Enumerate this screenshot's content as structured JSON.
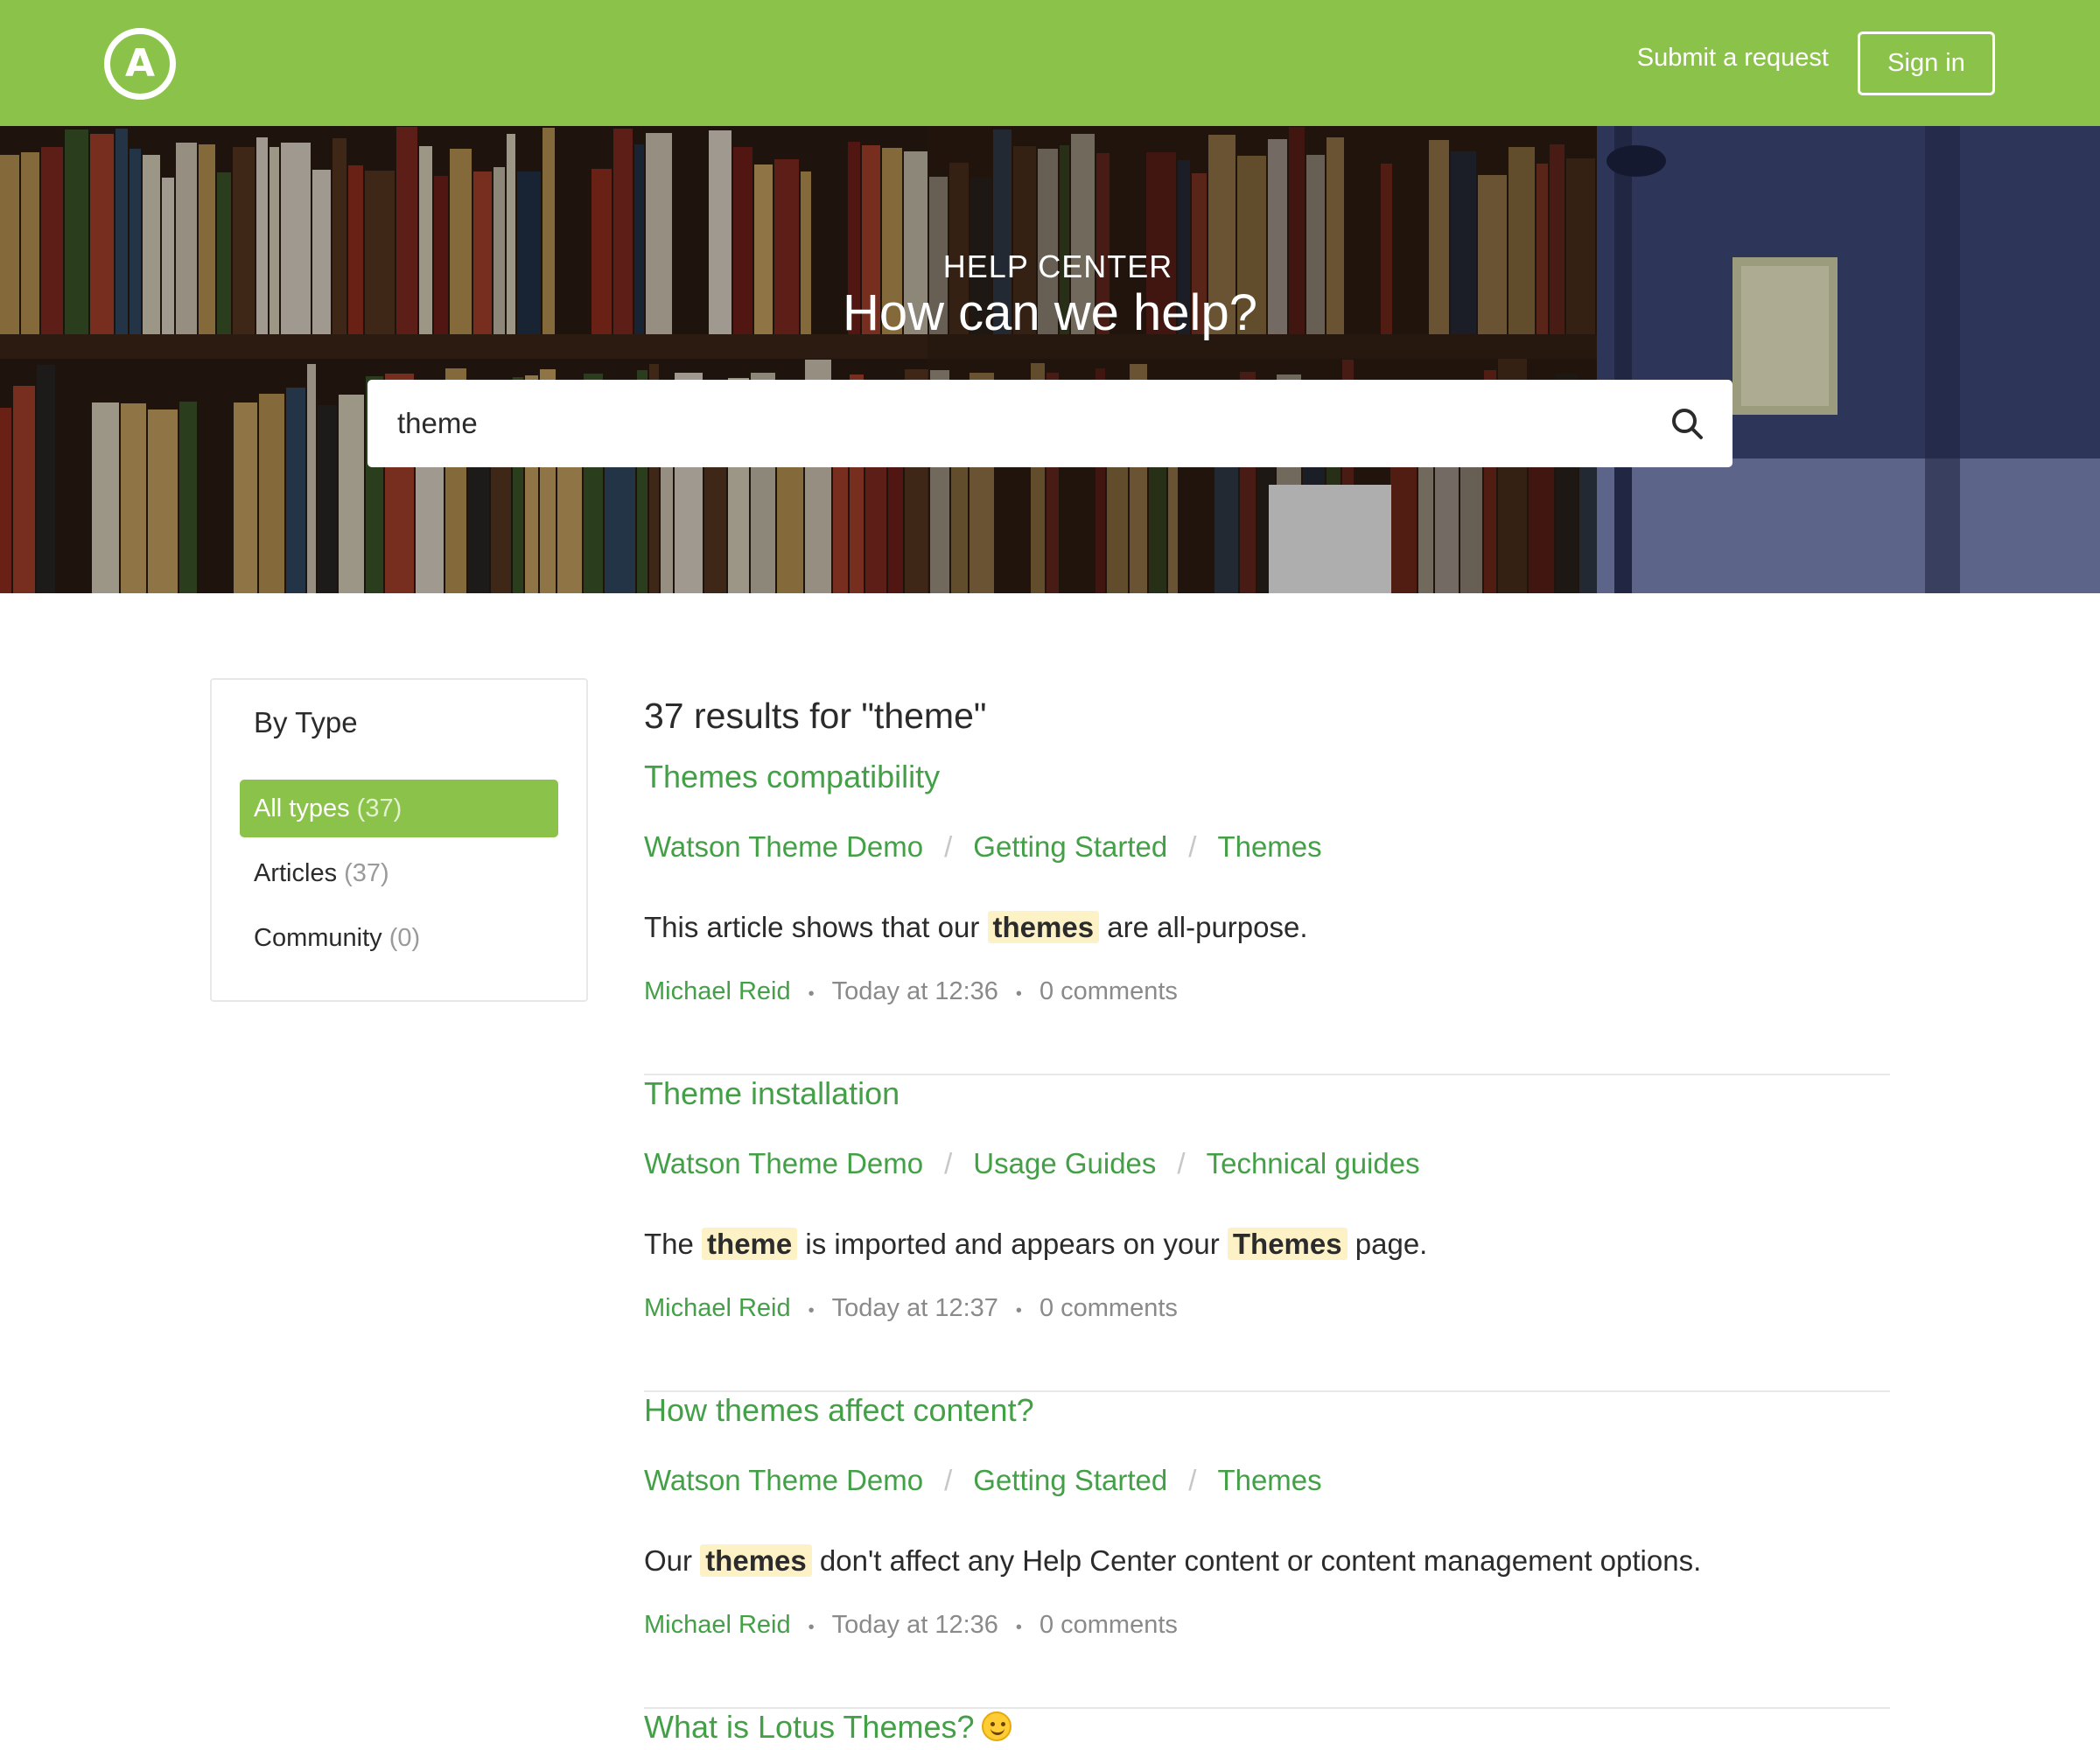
{
  "header": {
    "logo_letter": "A",
    "submit_label": "Submit a request",
    "signin_label": "Sign in",
    "accent_color": "#8bc34a"
  },
  "hero": {
    "eyebrow": "HELP CENTER",
    "title": "How can we help?",
    "search_value": "theme",
    "search_icon": "search-icon"
  },
  "sidebar": {
    "title": "By Type",
    "filters": [
      {
        "label": "All types",
        "count": "(37)",
        "active": true
      },
      {
        "label": "Articles",
        "count": "(37)",
        "active": false
      },
      {
        "label": "Community",
        "count": "(0)",
        "active": false
      }
    ]
  },
  "results": {
    "heading": "37 results for \"theme\"",
    "items": [
      {
        "title": "Themes compatibility",
        "crumbs": [
          "Watson Theme Demo",
          "Getting Started",
          "Themes"
        ],
        "snippet_parts": [
          "This article shows that our ",
          "themes",
          " are all-purpose."
        ],
        "author": "Michael Reid",
        "date": "Today at 12:36",
        "comments": "0 comments"
      },
      {
        "title": "Theme installation",
        "crumbs": [
          "Watson Theme Demo",
          "Usage Guides",
          "Technical guides"
        ],
        "snippet_parts": [
          "The ",
          "theme",
          " is imported and appears on your ",
          "Themes",
          " page."
        ],
        "author": "Michael Reid",
        "date": "Today at 12:37",
        "comments": "0 comments"
      },
      {
        "title": "How themes affect content?",
        "crumbs": [
          "Watson Theme Demo",
          "Getting Started",
          "Themes"
        ],
        "snippet_parts": [
          "Our ",
          "themes",
          " don't affect any Help Center content or content management options."
        ],
        "author": "Michael Reid",
        "date": "Today at 12:36",
        "comments": "0 comments"
      },
      {
        "title": "What is Lotus Themes?",
        "title_icon": "smiling-face-icon"
      }
    ]
  }
}
